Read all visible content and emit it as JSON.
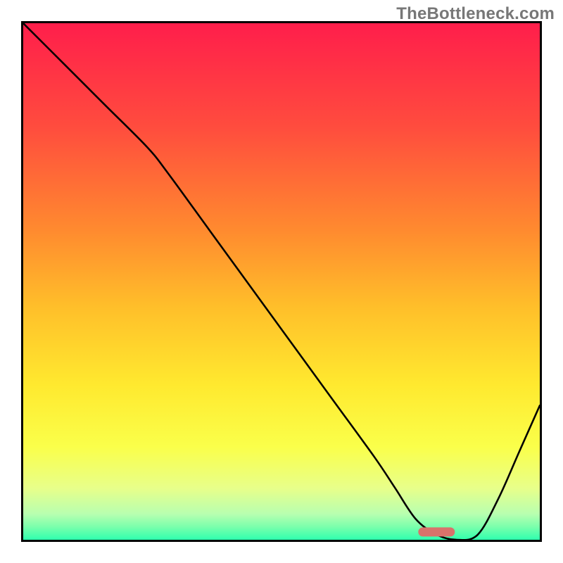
{
  "watermark": "TheBottleneck.com",
  "chart_data": {
    "type": "line",
    "title": "",
    "xlabel": "",
    "ylabel": "",
    "xlim": [
      0,
      100
    ],
    "ylim": [
      0,
      100
    ],
    "grid": false,
    "series": [
      {
        "name": "curve",
        "color": "#000000",
        "x": [
          0,
          8,
          16,
          24,
          28,
          36,
          44,
          52,
          60,
          68,
          72,
          76,
          80,
          84,
          88,
          92,
          96,
          100
        ],
        "values": [
          100,
          92,
          84,
          76,
          71,
          60,
          49,
          38,
          27,
          16,
          10,
          4,
          1,
          0,
          1,
          8,
          17,
          26
        ]
      }
    ],
    "marker": {
      "x": 80,
      "y": 1.5,
      "color": "#d9726b",
      "width_pct": 7,
      "height_pct": 1.8
    },
    "background_gradient": {
      "type": "vertical",
      "stops": [
        {
          "offset": 0.0,
          "color": "#ff1e4b"
        },
        {
          "offset": 0.2,
          "color": "#ff4c3e"
        },
        {
          "offset": 0.4,
          "color": "#ff8a2f"
        },
        {
          "offset": 0.55,
          "color": "#ffbf2a"
        },
        {
          "offset": 0.7,
          "color": "#ffe92f"
        },
        {
          "offset": 0.82,
          "color": "#faff4a"
        },
        {
          "offset": 0.9,
          "color": "#e8ff8a"
        },
        {
          "offset": 0.95,
          "color": "#b8ffb0"
        },
        {
          "offset": 0.975,
          "color": "#7affac"
        },
        {
          "offset": 1.0,
          "color": "#2fffae"
        }
      ]
    }
  }
}
